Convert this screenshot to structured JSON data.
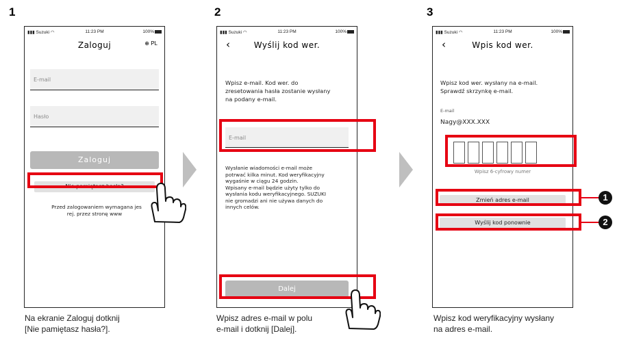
{
  "steps": [
    {
      "number": "1",
      "status": {
        "carrier": "Suzuki",
        "time": "11:23 PM",
        "battery": "100%"
      },
      "title": "Zaloguj",
      "language": "PL",
      "email_placeholder": "E-mail",
      "password_placeholder": "Hasło",
      "login_button": "Zaloguj",
      "forgot_button": "Nie pamiętasz hasła?",
      "note_line1": "Przed zalogowaniem wymagana jes",
      "note_line2": "rej. przez stronę www",
      "caption_line1": "Na ekranie Zaloguj dotknij",
      "caption_line2": "[Nie pamiętasz hasła?]."
    },
    {
      "number": "2",
      "status": {
        "carrier": "Suzuki",
        "time": "11:23 PM",
        "battery": "100%"
      },
      "title": "Wyślij kod wer.",
      "intro_lines": [
        "Wpisz e-mail. Kod wer. do",
        "zresetowania hasła zostanie wysłany",
        "na podany e-mail."
      ],
      "email_placeholder": "E-mail",
      "info_lines": [
        "Wysłanie wiadomości e-mail może",
        "potrwać kilka minut. Kod weryfikacyjny",
        "wygaśnie w ciągu 24 godzin.",
        "Wpisany e-mail będzie użyty tylko do",
        "wysłania kodu weryfikacyjnego. SUZUKI",
        "nie gromadzi ani nie używa danych do",
        "innych celów."
      ],
      "next_button": "Dalej",
      "caption_line1": "Wpisz adres e-mail w polu",
      "caption_line2": "e-mail i dotknij [Dalej]."
    },
    {
      "number": "3",
      "status": {
        "carrier": "Suzuki",
        "time": "11:23 PM",
        "battery": "100%"
      },
      "title": "Wpis kod wer.",
      "intro_lines": [
        "Wpisz kod wer. wysłany na e-mail.",
        "Sprawdź skrzynkę e-mail."
      ],
      "email_label": "E-mail",
      "email_value": "Nagy@XXX.XXX",
      "code_hint": "Wpisz 6-cyfrowy numer",
      "change_email_button": "Zmień adres e-mail",
      "resend_button": "Wyślij kod ponownie",
      "callout1": "1",
      "callout2": "2",
      "caption_line1": "Wpisz kod weryfikacyjny wysłany",
      "caption_line2": "na adres e-mail."
    }
  ]
}
